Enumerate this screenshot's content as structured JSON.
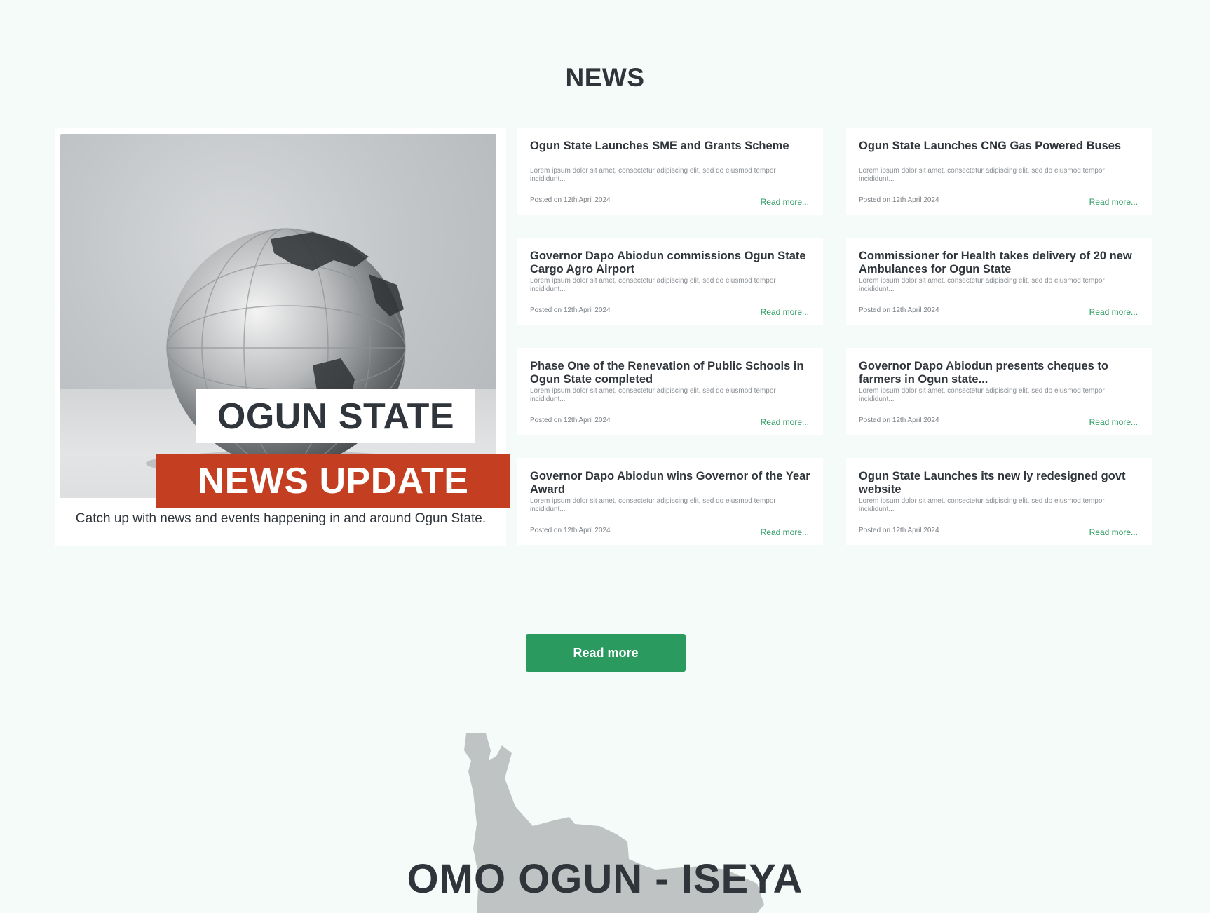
{
  "news": {
    "section_title": "NEWS",
    "feature": {
      "banner_top": "OGUN STATE",
      "banner_bottom": "NEWS UPDATE",
      "caption": "Catch up with news and events happening in and around Ogun State."
    },
    "cards": [
      {
        "title": "Ogun State Launches SME and Grants Scheme",
        "excerpt": "Lorem ipsum dolor sit amet, consectetur adipiscing elit, sed do eiusmod tempor incididunt...",
        "date": "Posted on 12th April 2024",
        "link": "Read more..."
      },
      {
        "title": "Ogun State Launches CNG Gas Powered Buses",
        "excerpt": "Lorem ipsum dolor sit amet, consectetur adipiscing elit, sed do eiusmod tempor incididunt...",
        "date": "Posted on 12th April 2024",
        "link": "Read more..."
      },
      {
        "title": "Governor Dapo Abiodun commissions Ogun State Cargo Agro Airport",
        "excerpt": "Lorem ipsum dolor sit amet, consectetur adipiscing elit, sed do eiusmod tempor incididunt...",
        "date": "Posted on 12th April 2024",
        "link": "Read more..."
      },
      {
        "title": "Commissioner for Health takes delivery of 20 new Ambulances for Ogun State",
        "excerpt": "Lorem ipsum dolor sit amet, consectetur adipiscing elit, sed do eiusmod tempor incididunt...",
        "date": "Posted on 12th April 2024",
        "link": "Read more..."
      },
      {
        "title": "Phase One of the Renevation of Public Schools in Ogun State completed",
        "excerpt": "Lorem ipsum dolor sit amet, consectetur adipiscing elit, sed do eiusmod tempor incididunt...",
        "date": "Posted on 12th April 2024",
        "link": "Read more..."
      },
      {
        "title": "Governor Dapo Abiodun presents cheques to farmers in Ogun state...",
        "excerpt": "Lorem ipsum dolor sit amet, consectetur adipiscing elit, sed do eiusmod tempor incididunt...",
        "date": "Posted on 12th April 2024",
        "link": "Read more..."
      },
      {
        "title": "Governor Dapo Abiodun wins Governor of the Year Award",
        "excerpt": "Lorem ipsum dolor sit amet, consectetur adipiscing elit, sed do eiusmod tempor incididunt...",
        "date": "Posted on 12th April 2024",
        "link": "Read more..."
      },
      {
        "title": "Ogun State Launches its new ly redesigned govt website",
        "excerpt": "Lorem ipsum dolor sit amet, consectetur adipiscing elit, sed do eiusmod tempor incididunt...",
        "date": "Posted on 12th April 2024",
        "link": "Read more..."
      }
    ],
    "read_more_button": "Read more"
  },
  "iseya": {
    "title": "OMO OGUN - ISEYA"
  },
  "colors": {
    "background": "#f5fbf8",
    "accent_green": "#2a9a5f",
    "banner_red": "#c43f21",
    "heading": "#2f353b",
    "map_gray": "#bfc3c3"
  },
  "icons": {
    "feature_image": "silver-globe-image",
    "map": "ogun-state-map-silhouette"
  }
}
